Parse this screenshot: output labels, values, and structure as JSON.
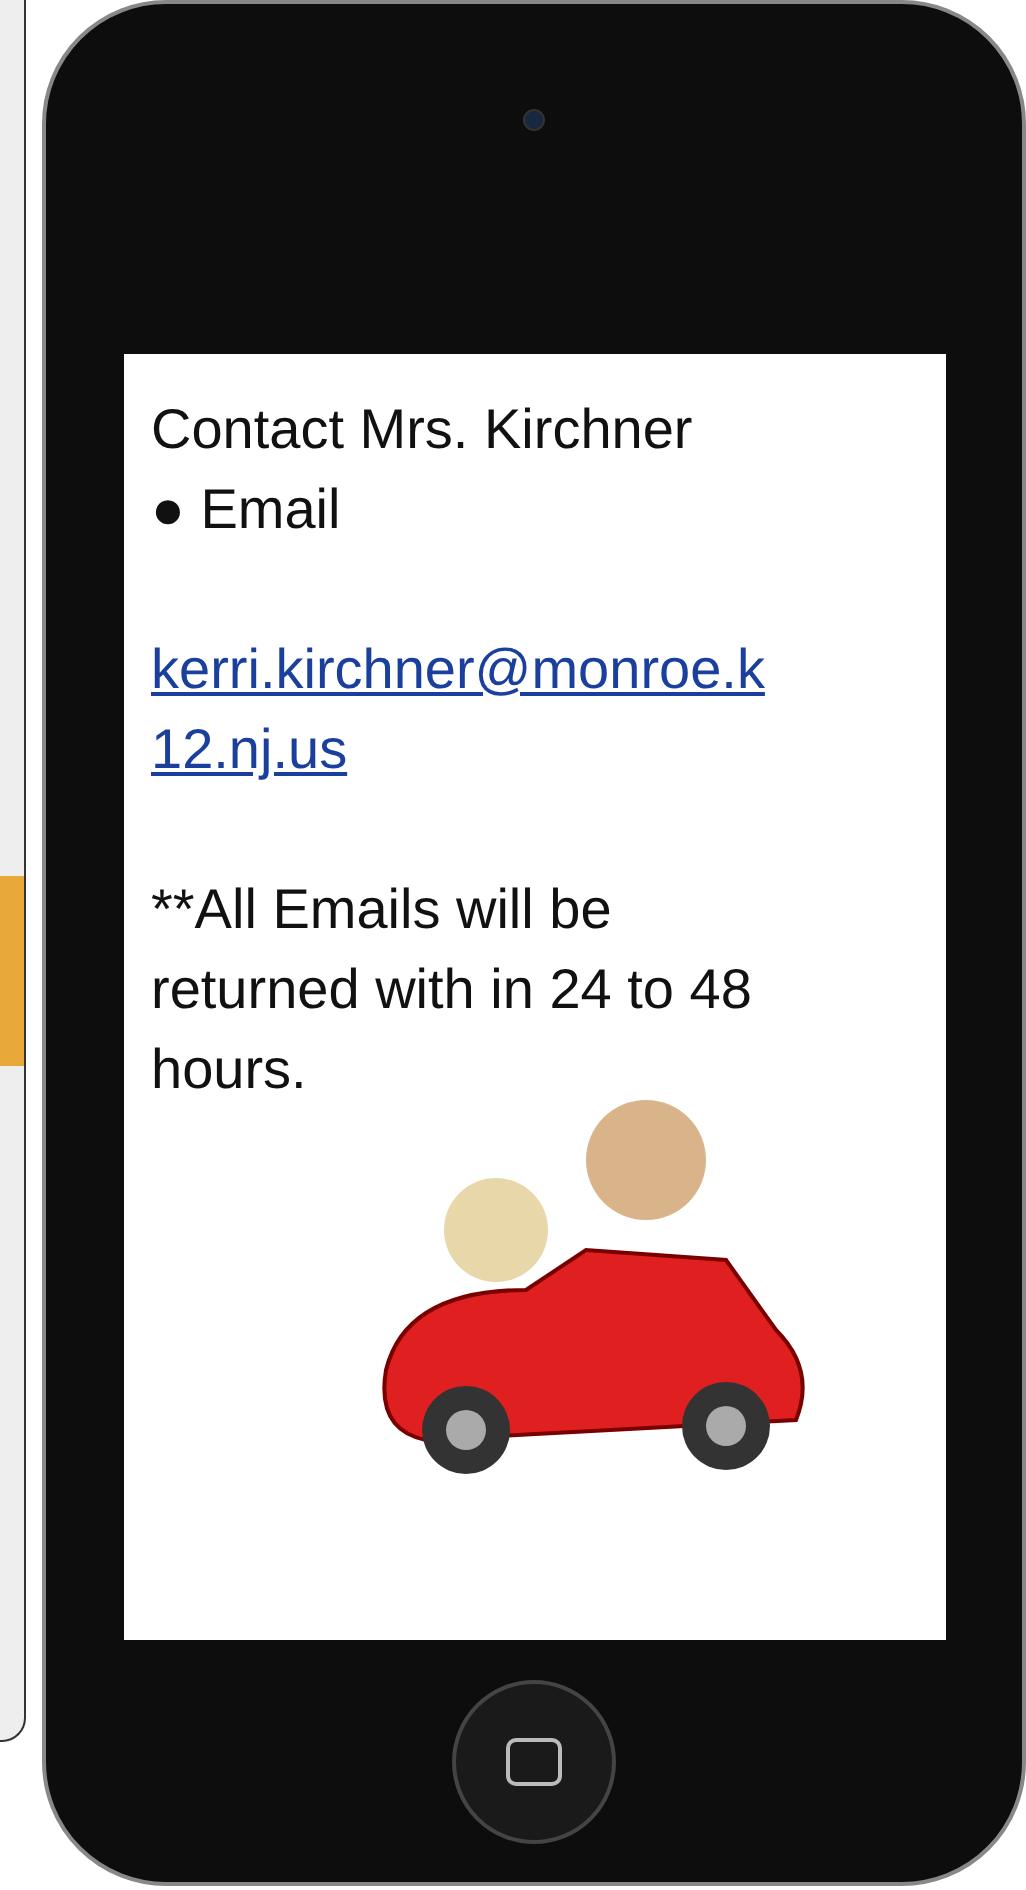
{
  "contact": {
    "title": "Contact Mrs. Kirchner",
    "items": [
      "● Email"
    ],
    "email": "kerri.kirchner@monroe.k12.nj.us",
    "note": "**All Emails will be returned with in 24 to 48 hours."
  }
}
